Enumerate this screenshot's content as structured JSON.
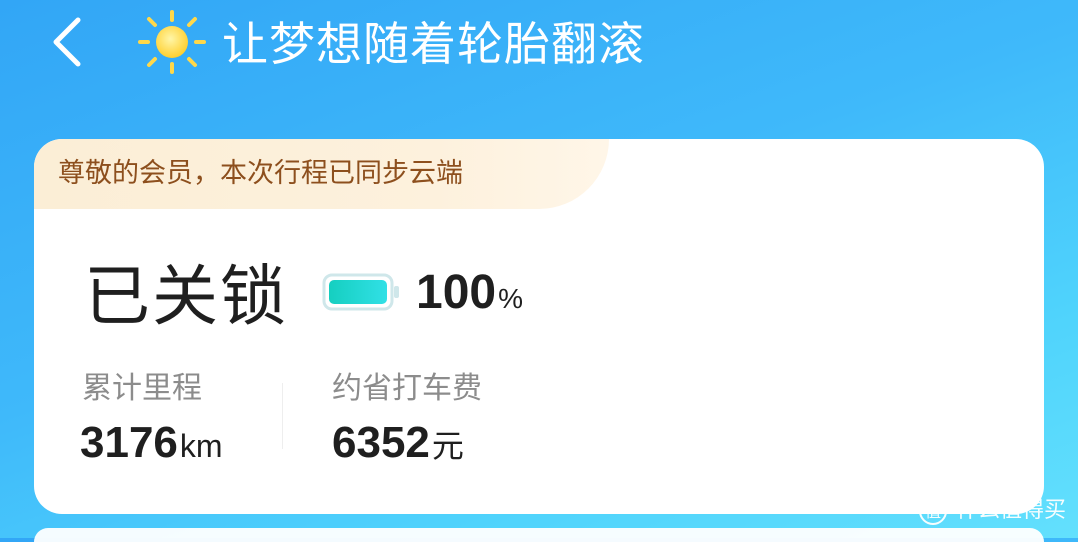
{
  "header": {
    "back_icon": "chevron-left-icon",
    "sun_icon": "sun-icon",
    "title": "让梦想随着轮胎翻滚"
  },
  "card": {
    "notice": "尊敬的会员，本次行程已同步云端",
    "lock_status": "已关锁",
    "battery": {
      "icon": "battery-full-icon",
      "value": "100",
      "unit": "%",
      "level": 1.0
    },
    "stats": [
      {
        "label": "累计里程",
        "value": "3176",
        "unit": "km"
      },
      {
        "label": "约省打车费",
        "value": "6352",
        "unit": "元"
      }
    ]
  },
  "watermark": {
    "logo": "zhi-logo-icon",
    "text": "什么值得买"
  },
  "colors": {
    "background_top": "#32a6f6",
    "background_bottom": "#63e0fd",
    "notice_bg": "#fbeed6",
    "notice_text": "#8d4f1d",
    "battery_fill": "#1fd6c7"
  }
}
